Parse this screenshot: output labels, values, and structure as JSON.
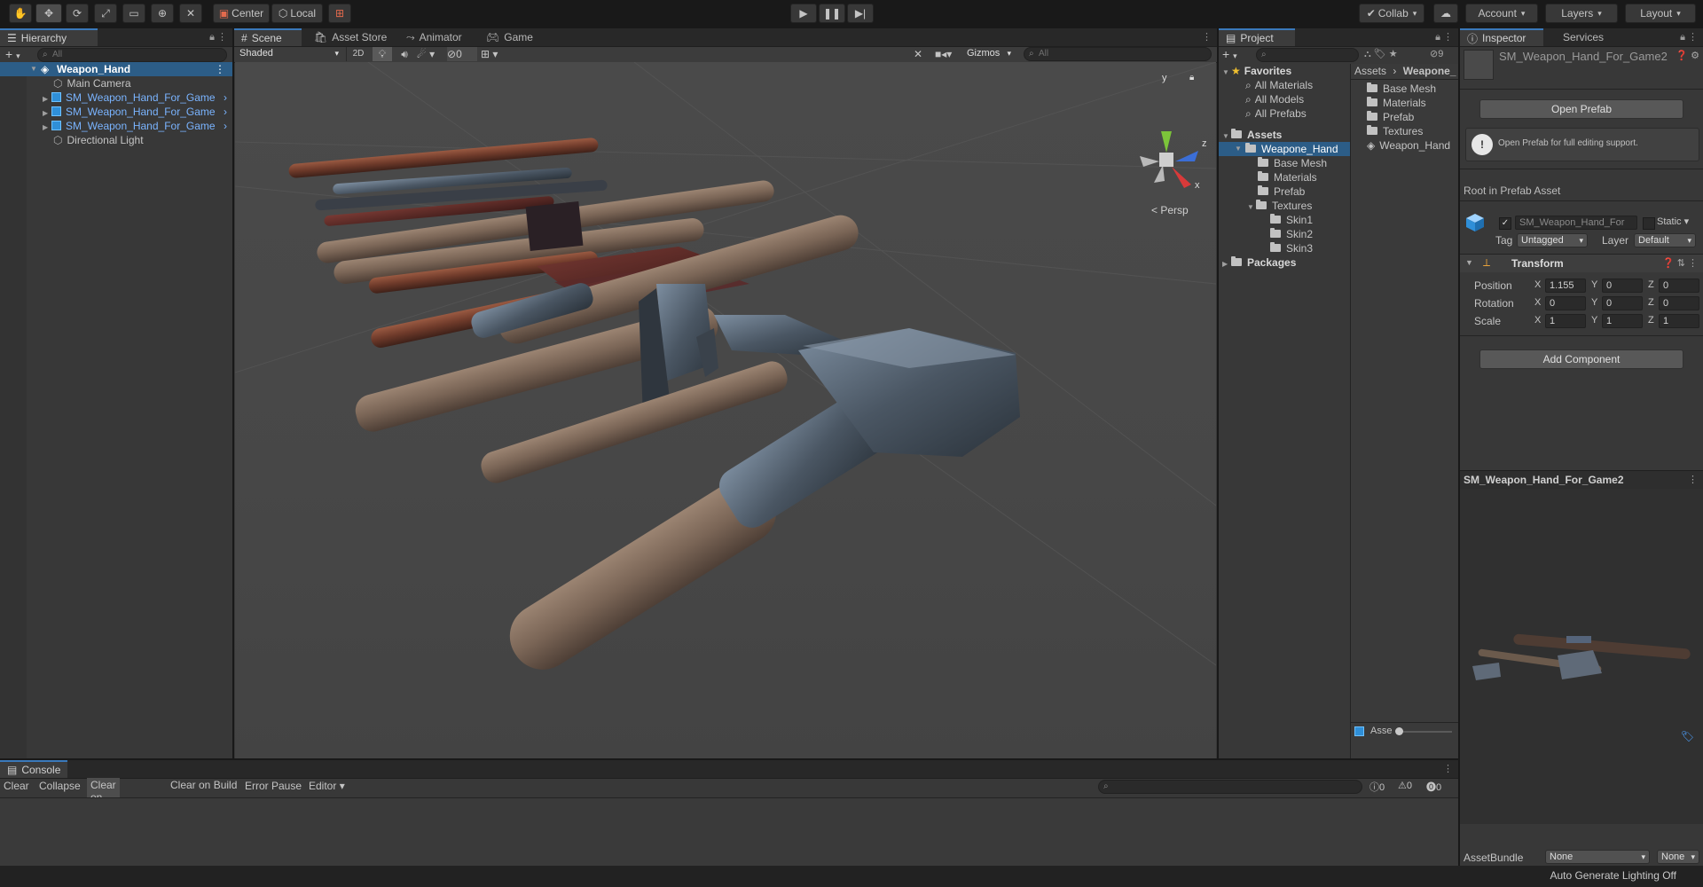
{
  "toolbar": {
    "pivot_center": "Center",
    "pivot_local": "Local",
    "collab": "Collab",
    "account": "Account",
    "layers": "Layers",
    "layout": "Layout"
  },
  "hierarchy": {
    "tab": "Hierarchy",
    "search_placeholder": "All",
    "scene_name": "Weapon_Hand",
    "items": [
      {
        "label": "Main Camera"
      },
      {
        "label": "SM_Weapon_Hand_For_Game"
      },
      {
        "label": "SM_Weapon_Hand_For_Game"
      },
      {
        "label": "SM_Weapon_Hand_For_Game"
      },
      {
        "label": "Directional Light"
      }
    ]
  },
  "scene": {
    "tabs": [
      {
        "label": "Scene"
      },
      {
        "label": "Asset Store"
      },
      {
        "label": "Animator"
      },
      {
        "label": "Game"
      }
    ],
    "shading": "Shaded",
    "mode_2d": "2D",
    "hidden_count": "0",
    "gizmos": "Gizmos",
    "search_placeholder": "All",
    "persp_label": "< Persp",
    "axis_x": "x",
    "axis_y": "y",
    "axis_z": "z"
  },
  "project": {
    "tab": "Project",
    "badge": "9",
    "favorites_label": "Favorites",
    "favorites": [
      {
        "label": "All Materials"
      },
      {
        "label": "All Models"
      },
      {
        "label": "All Prefabs"
      }
    ],
    "assets_label": "Assets",
    "tree": [
      {
        "label": "Weapone_Hand"
      },
      {
        "label": "Base Mesh"
      },
      {
        "label": "Materials"
      },
      {
        "label": "Prefab"
      },
      {
        "label": "Textures"
      },
      {
        "label": "Skin1"
      },
      {
        "label": "Skin2"
      },
      {
        "label": "Skin3"
      }
    ],
    "packages_label": "Packages",
    "breadcrumb_root": "Assets",
    "breadcrumb_child": "Weapone_",
    "contents": [
      {
        "label": "Base Mesh"
      },
      {
        "label": "Materials"
      },
      {
        "label": "Prefab"
      },
      {
        "label": "Textures"
      },
      {
        "label": "Weapon_Hand"
      }
    ],
    "footer": "Asse"
  },
  "inspector": {
    "tab": "Inspector",
    "tab2": "Services",
    "asset_name": "SM_Weapon_Hand_For_Game2",
    "open_prefab": "Open Prefab",
    "info_text": "Open Prefab for full editing support.",
    "root_label": "Root in Prefab Asset",
    "object_name": "SM_Weapon_Hand_For",
    "static_label": "Static",
    "tag_label": "Tag",
    "tag_value": "Untagged",
    "layer_label": "Layer",
    "layer_value": "Default",
    "transform_label": "Transform",
    "position_label": "Position",
    "rotation_label": "Rotation",
    "scale_label": "Scale",
    "position": {
      "x": "1.155",
      "y": "0",
      "z": "0"
    },
    "rotation": {
      "x": "0",
      "y": "0",
      "z": "0"
    },
    "scale": {
      "x": "1",
      "y": "1",
      "z": "1"
    },
    "axis_x": "X",
    "axis_y": "Y",
    "axis_z": "Z",
    "add_component": "Add Component",
    "preview_title": "SM_Weapon_Hand_For_Game2",
    "assetbundle_label": "AssetBundle",
    "assetbundle_value": "None",
    "assetbundle_variant": "None"
  },
  "console": {
    "tab": "Console",
    "buttons": [
      {
        "label": "Clear"
      },
      {
        "label": "Collapse"
      },
      {
        "label": "Clear on Play"
      },
      {
        "label": "Clear on Build"
      },
      {
        "label": "Error Pause"
      },
      {
        "label": "Editor"
      }
    ],
    "info_count": "0",
    "warn_count": "0",
    "error_count": "0"
  },
  "status": {
    "lighting": "Auto Generate Lighting Off"
  },
  "colors": {
    "accent": "#3a79bb",
    "prefab_blue": "#7ab4ff",
    "selection": "#2c5d87"
  }
}
